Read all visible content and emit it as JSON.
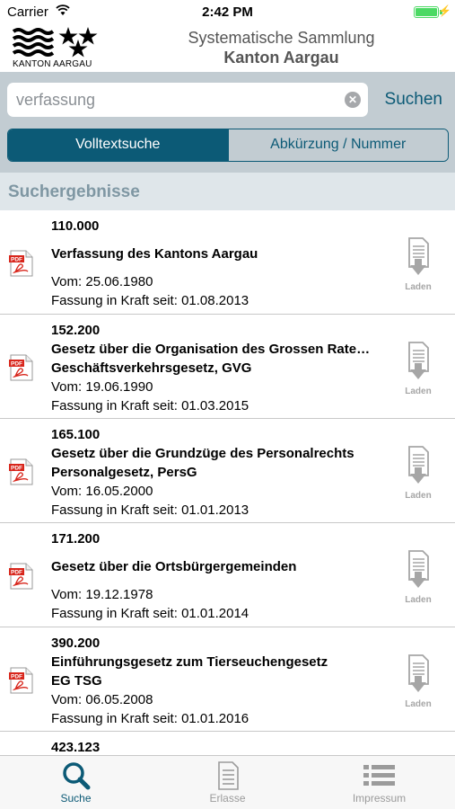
{
  "status": {
    "carrier": "Carrier",
    "time": "2:42 PM"
  },
  "header": {
    "logo_text": "KANTON AARGAU",
    "title_line1": "Systematische Sammlung",
    "title_line2": "Kanton Aargau"
  },
  "search": {
    "value": "verfassung",
    "button": "Suchen"
  },
  "segments": {
    "fulltext": "Volltextsuche",
    "abbreviation": "Abkürzung / Nummer",
    "selected": "fulltext"
  },
  "section_title": "Suchergebnisse",
  "results": [
    {
      "number": "110.000",
      "title": "Verfassung des Kantons Aargau",
      "subtitle": "",
      "date": "Vom: 25.06.1980",
      "in_force": "Fassung in Kraft seit: 01.08.2013",
      "download": "Laden"
    },
    {
      "number": "152.200",
      "title": "Gesetz über die Organisation des Grossen Rate…",
      "subtitle": "Geschäftsverkehrsgesetz, GVG",
      "date": "Vom: 19.06.1990",
      "in_force": "Fassung in Kraft seit: 01.03.2015",
      "download": "Laden"
    },
    {
      "number": "165.100",
      "title": "Gesetz über die Grundzüge des Personalrechts",
      "subtitle": "Personalgesetz, PersG",
      "date": "Vom: 16.05.2000",
      "in_force": "Fassung in Kraft seit: 01.01.2013",
      "download": "Laden"
    },
    {
      "number": "171.200",
      "title": "Gesetz über die Ortsbürgergemeinden",
      "subtitle": "",
      "date": "Vom: 19.12.1978",
      "in_force": "Fassung in Kraft seit: 01.01.2014",
      "download": "Laden"
    },
    {
      "number": "390.200",
      "title": "Einführungsgesetz zum Tierseuchengesetz",
      "subtitle": "EG TSG",
      "date": "Vom: 06.05.2008",
      "in_force": "Fassung in Kraft seit: 01.01.2016",
      "download": "Laden"
    },
    {
      "number": "423.123",
      "title": "",
      "subtitle": "",
      "date": "",
      "in_force": "",
      "download": ""
    }
  ],
  "tabs": [
    {
      "label": "Suche",
      "icon": "search-icon",
      "active": true
    },
    {
      "label": "Erlasse",
      "icon": "document-icon",
      "active": false
    },
    {
      "label": "Impressum",
      "icon": "list-icon",
      "active": false
    }
  ],
  "colors": {
    "accent": "#0c5a76",
    "search_bg": "#c2ccd2",
    "section_bg": "#dfe6ea",
    "battery": "#4cd964"
  }
}
